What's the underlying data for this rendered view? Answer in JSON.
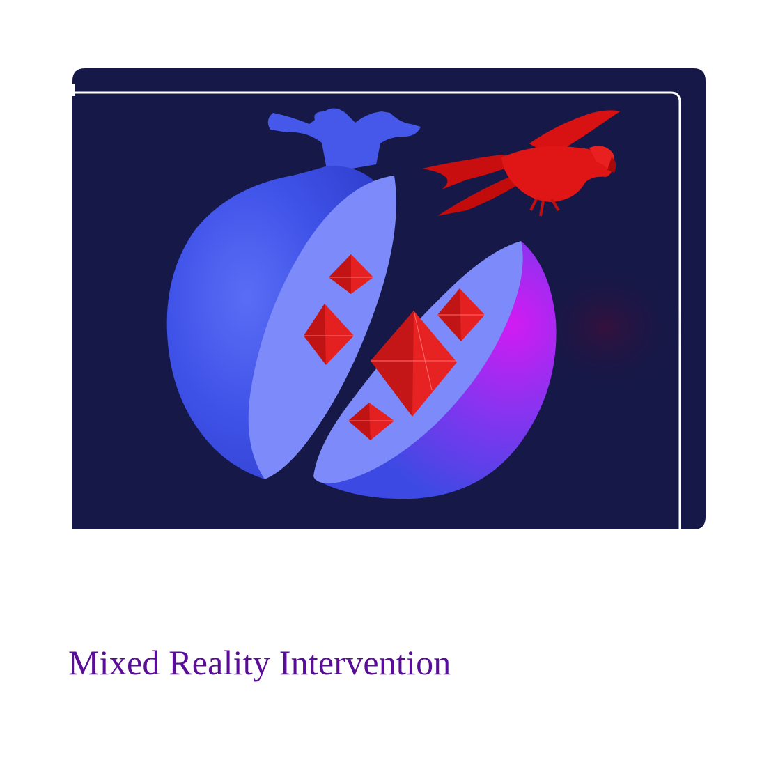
{
  "caption": {
    "text": "Mixed Reality Intervention"
  },
  "colors": {
    "panel": "#161848",
    "frame_line": "#ffffff",
    "fruit_blue": "#3f52e8",
    "fruit_light": "#7d8bfa",
    "fruit_magenta": "#c21cf0",
    "crystal_red": "#e01818",
    "bird_red": "#d81010",
    "caption_color": "#5a0e98"
  },
  "icons": {
    "fruit": "pomegranate-icon",
    "bird": "parrot-icon",
    "crystals": "octahedron-crystal-icon"
  }
}
